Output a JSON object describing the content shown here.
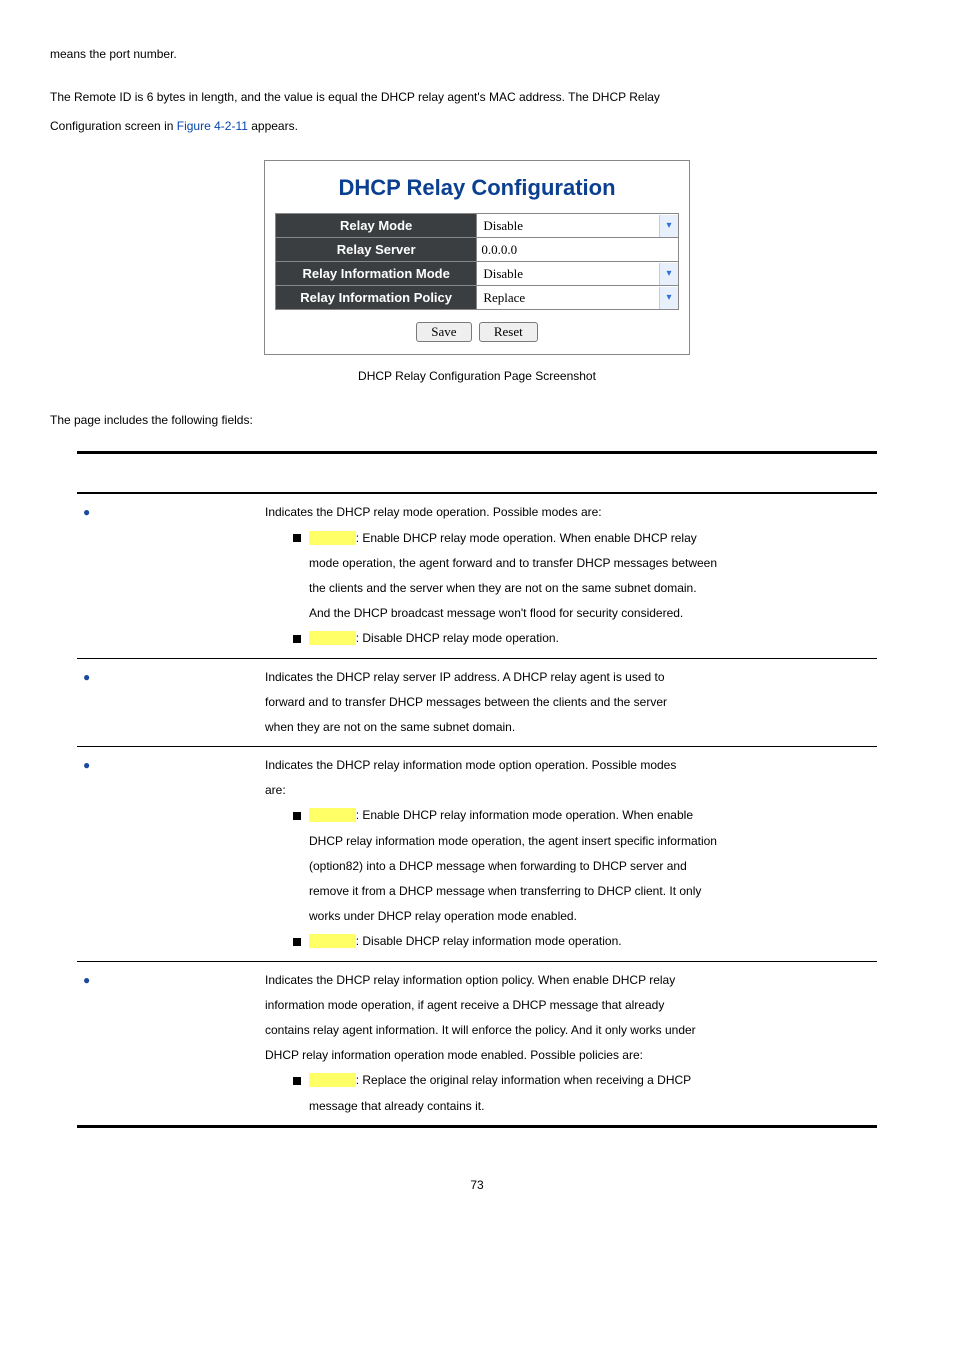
{
  "intro": {
    "line1": "means the port number.",
    "line2a": "The Remote ID is 6 bytes in length, and the value is equal the DHCP relay agent's MAC address. The DHCP Relay",
    "line2b_prefix": "Configuration screen in ",
    "line2b_link": "Figure 4-2-11",
    "line2b_suffix": " appears."
  },
  "panel": {
    "title": "DHCP Relay Configuration",
    "rows": {
      "relay_mode": {
        "label": "Relay Mode",
        "value": "Disable",
        "type": "select"
      },
      "relay_server": {
        "label": "Relay Server",
        "value": "0.0.0.0",
        "type": "text"
      },
      "relay_info_mode": {
        "label": "Relay Information Mode",
        "value": "Disable",
        "type": "select"
      },
      "relay_info_policy": {
        "label": "Relay Information Policy",
        "value": "Replace",
        "type": "select"
      }
    },
    "buttons": {
      "save": "Save",
      "reset": "Reset"
    }
  },
  "caption": "DHCP Relay Configuration Page Screenshot",
  "fields_label": "The page includes the following fields:",
  "table": {
    "rows": [
      {
        "desc_lead": "Indicates the DHCP relay mode operation. Possible modes are:",
        "items": [
          {
            "after_hl": ": Enable DHCP relay mode operation. When enable DHCP relay",
            "cont": [
              "mode operation, the agent forward and to transfer DHCP messages between",
              "the clients and the server when they are not on the same subnet domain.",
              "And the DHCP broadcast message won't flood for security considered."
            ]
          },
          {
            "after_hl": ": Disable DHCP relay mode operation.",
            "cont": []
          }
        ]
      },
      {
        "desc_lead": "Indicates the DHCP relay server IP address. A DHCP relay agent is used to",
        "plain_cont": [
          "forward and to transfer DHCP messages between the clients and the server",
          "when they are not on the same subnet domain."
        ]
      },
      {
        "desc_lead": "Indicates the DHCP relay information mode option operation. Possible modes",
        "plain_cont": [
          "are:"
        ],
        "items": [
          {
            "after_hl": ": Enable DHCP relay information mode operation. When enable",
            "cont": [
              "DHCP relay information mode operation, the agent insert specific information",
              "(option82) into a DHCP message when forwarding to DHCP server and",
              "remove it from a DHCP message when transferring to DHCP client. It only",
              "works under DHCP relay operation mode enabled."
            ]
          },
          {
            "after_hl": ": Disable DHCP relay information mode operation.",
            "cont": []
          }
        ]
      },
      {
        "desc_lead": "Indicates the DHCP relay information option policy. When enable DHCP relay",
        "plain_cont": [
          "information mode operation, if agent receive a DHCP message that already",
          "contains relay agent information. It will enforce the policy. And it only works under",
          "DHCP relay information operation mode enabled. Possible policies are:"
        ],
        "items": [
          {
            "after_hl": ": Replace the original relay information when receiving a DHCP",
            "cont": [
              "message that already contains it."
            ]
          }
        ]
      }
    ]
  },
  "pagenum": "73"
}
